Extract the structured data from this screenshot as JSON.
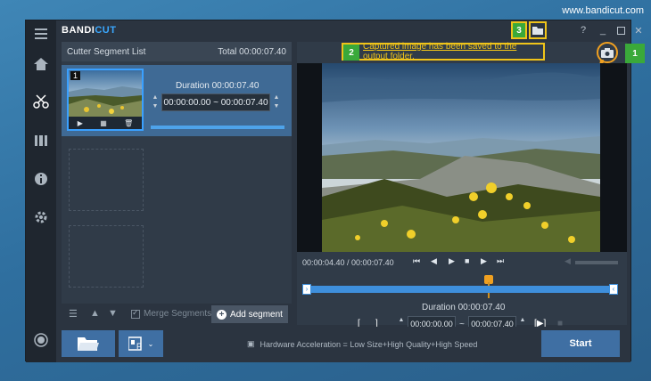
{
  "watermark": "www.bandicut.com",
  "app": {
    "logo_main": "BANDI",
    "logo_accent": "CUT",
    "window_buttons": {
      "help": "?",
      "minimize": "_",
      "close": "✕"
    }
  },
  "left_panel": {
    "title": "Cutter Segment List",
    "total": "Total 00:00:07.40",
    "segment": {
      "number": "1",
      "duration": "Duration 00:00:07.40",
      "range": "00:00:00.00 ~ 00:00:07.40"
    },
    "footer": {
      "merge_label": "Merge Segments",
      "add_segment": "Add segment"
    }
  },
  "right_panel": {
    "banner": "Captured image has been saved to the output folder.",
    "badges": {
      "one": "1",
      "two": "2",
      "three": "3"
    },
    "time": "00:00:04.40 / 00:00:07.40",
    "duration": "Duration 00:00:07.40",
    "range_start": "00:00:00.00",
    "range_sep": "~",
    "range_end": "00:00:07.40",
    "bracket_open": "[",
    "bracket_close": "]"
  },
  "bottom": {
    "hw_text": "Hardware Acceleration = Low Size+High Quality+High Speed",
    "start": "Start"
  },
  "colors": {
    "accent": "#3aa8ff",
    "badge": "#3aa93a",
    "highlight": "#f0c419",
    "button": "#3f6fa3"
  }
}
